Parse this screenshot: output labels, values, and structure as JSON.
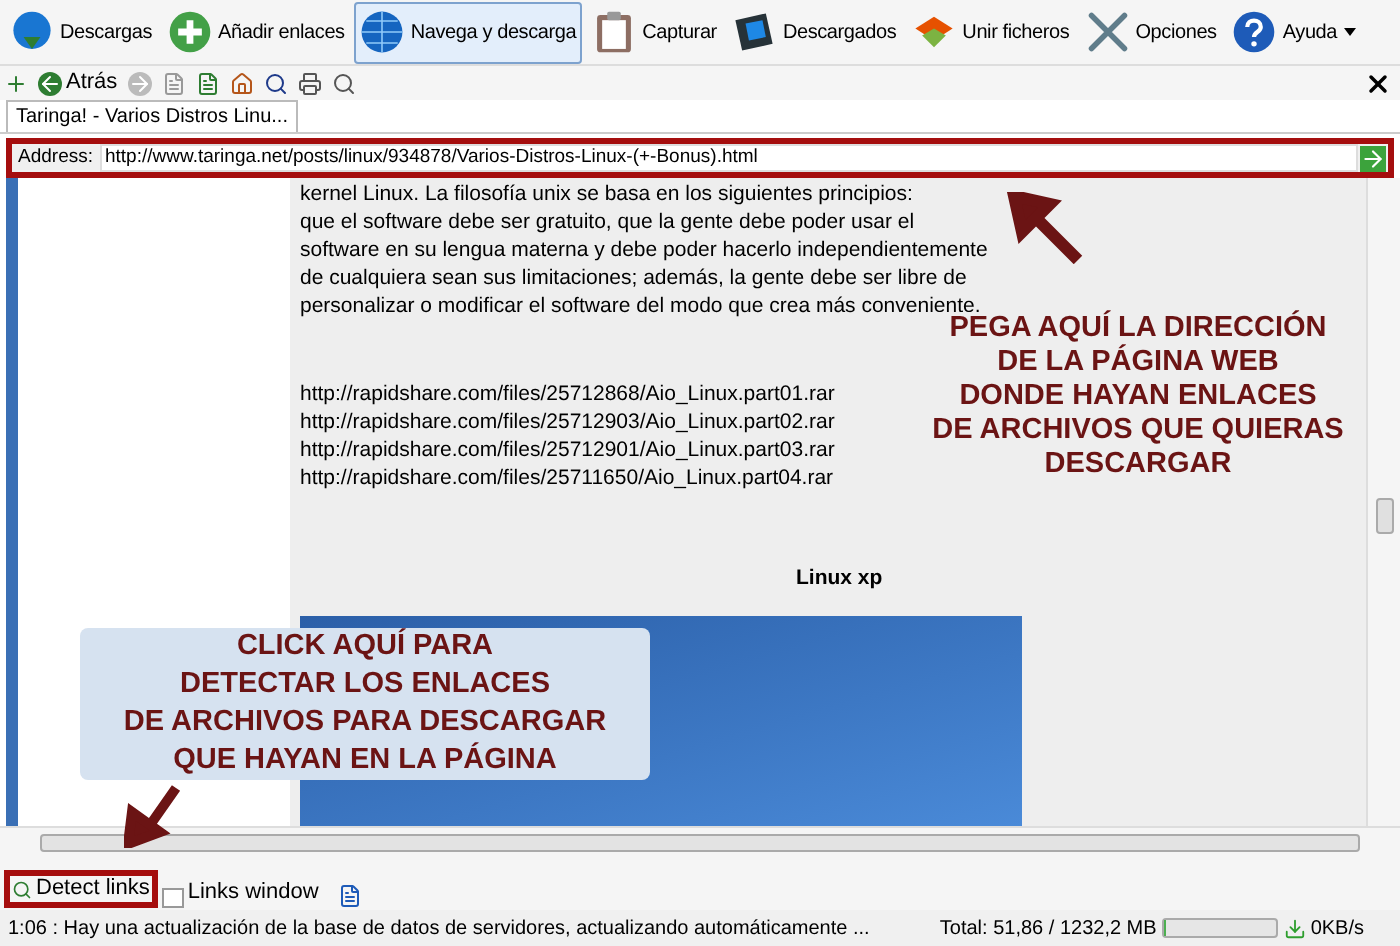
{
  "toolbar": [
    {
      "label": "Descargas",
      "selected": false,
      "dropdown": false
    },
    {
      "label": "Añadir enlaces",
      "selected": false,
      "dropdown": false
    },
    {
      "label": "Navega y descarga",
      "selected": true,
      "dropdown": false
    },
    {
      "label": "Capturar",
      "selected": false,
      "dropdown": false
    },
    {
      "label": "Descargados",
      "selected": false,
      "dropdown": false
    },
    {
      "label": "Unir ficheros",
      "selected": false,
      "dropdown": false
    },
    {
      "label": "Opciones",
      "selected": false,
      "dropdown": false
    },
    {
      "label": "Ayuda",
      "selected": false,
      "dropdown": true
    }
  ],
  "nav_toolbar": {
    "back_label": "Atrás"
  },
  "tabs": [
    {
      "label": "Taringa! - Varios Distros Linu...",
      "selected": true
    }
  ],
  "address": {
    "label": "Address:",
    "value": "http://www.taringa.net/posts/linux/934878/Varios-Distros-Linux-(+-Bonus).html"
  },
  "page": {
    "paragraph_lines": [
      "kernel Linux. La filosofía unix se basa en los siguientes principios:",
      "que el software debe ser gratuito, que la gente debe poder usar el",
      "software en su lengua materna y debe poder hacerlo independientemente",
      "de cualquiera sean sus limitaciones; además, la gente debe ser libre de",
      "personalizar o modificar el software del modo que crea más conveniente."
    ],
    "links": [
      "http://rapidshare.com/files/25712868/Aio_Linux.part01.rar",
      "http://rapidshare.com/files/25712903/Aio_Linux.part02.rar",
      "http://rapidshare.com/files/25712901/Aio_Linux.part03.rar",
      "http://rapidshare.com/files/25711650/Aio_Linux.part04.rar"
    ],
    "image_caption": "Linux xp"
  },
  "annotations": [
    {
      "text": "PEGA AQUÍ LA DIRECCIÓN\nDE LA PÁGINA WEB\nDONDE HAYAN ENLACES\nDE ARCHIVOS QUE QUIERAS\nDESCARGAR"
    },
    {
      "text": "CLICK AQUÍ PARA\nDETECTAR LOS ENLACES\nDE ARCHIVOS PARA DESCARGAR\nQUE HAYAN EN LA PÁGINA"
    }
  ],
  "bottom_toolbar": {
    "detect_label": "Detect links",
    "links_window_label": "Links window",
    "links_window_checked": false
  },
  "status_bar": {
    "message": "1:06 : Hay una actualización de la base de datos de servidores, actualizando automáticamente ...",
    "total": "Total: 51,86 / 1232,2 MB",
    "level": 0.02,
    "speed": "0KB/s"
  }
}
